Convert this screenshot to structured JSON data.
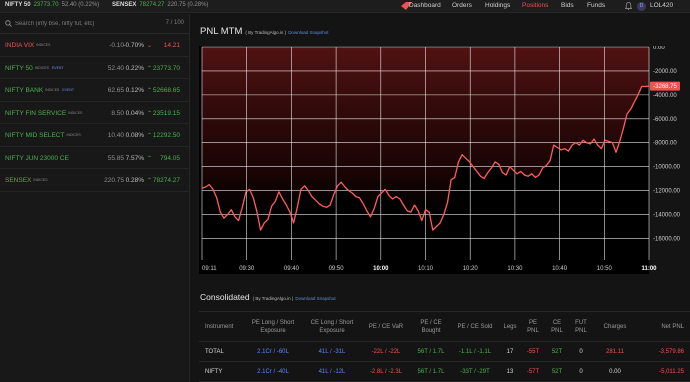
{
  "colors": {
    "green": "#4caf50",
    "red": "#ef5350",
    "blue": "#5c86ff",
    "accent": "#ef5350",
    "bg": "#141414"
  },
  "topbar": {
    "tickers": [
      {
        "name": "NIFTY 50",
        "value": "23773.70",
        "change": "52.40 (0.22%)"
      },
      {
        "name": "SENSEX",
        "value": "78274.27",
        "change": "220.75 (0.28%)"
      }
    ],
    "logo_icon": "kite-logo-icon",
    "nav": [
      "Dashboard",
      "Orders",
      "Holdings",
      "Positions",
      "Bids",
      "Funds"
    ],
    "active_nav": "Positions",
    "user_initial": "D",
    "user_id": "LOL420"
  },
  "watchlist": {
    "search_placeholder": "Search (infy bse, nifty fut, etc)",
    "count": "7 / 100",
    "items": [
      {
        "name": "INDIA VIX",
        "tag": "INDICES",
        "event": "",
        "change": "-0.10",
        "pct": "-0.70%",
        "dir": "down",
        "ltp": "14.21",
        "name_color": "red"
      },
      {
        "name": "NIFTY 50",
        "tag": "INDICES",
        "event": "EVENT",
        "change": "52.40",
        "pct": "0.22%",
        "dir": "up",
        "ltp": "23773.70",
        "name_color": "green"
      },
      {
        "name": "NIFTY BANK",
        "tag": "INDICES",
        "event": "EVENT",
        "change": "62.65",
        "pct": "0.12%",
        "dir": "up",
        "ltp": "52668.65",
        "name_color": "green"
      },
      {
        "name": "NIFTY FIN SERVICE",
        "tag": "INDICES",
        "event": "",
        "change": "8.50",
        "pct": "0.04%",
        "dir": "up",
        "ltp": "23519.15",
        "name_color": "green"
      },
      {
        "name": "NIFTY MID SELECT",
        "tag": "INDICES",
        "event": "",
        "change": "10.40",
        "pct": "0.08%",
        "dir": "up",
        "ltp": "12292.50",
        "name_color": "green"
      },
      {
        "name": "NIFTY JUN 23000 CE",
        "tag": "",
        "event": "",
        "change": "55.85",
        "pct": "7.57%",
        "dir": "up",
        "ltp": "794.05",
        "name_color": "green"
      },
      {
        "name": "SENSEX",
        "tag": "INDICES",
        "event": "",
        "change": "220.75",
        "pct": "0.28%",
        "dir": "up",
        "ltp": "78274.27",
        "name_color": "green"
      }
    ]
  },
  "pnl": {
    "title": "PNL MTM",
    "by": "( By TradingAlgo.in )",
    "download": "Download Snapshot"
  },
  "chart_data": {
    "type": "area",
    "title": "",
    "xlabel": "",
    "ylabel": "",
    "x_ticks": [
      "09:11",
      "09:30",
      "09:40",
      "09:50",
      "10:00",
      "10:10",
      "10:20",
      "10:30",
      "10:40",
      "10:50",
      "11:00"
    ],
    "x_ticks_bold": [
      "10:00",
      "11:00"
    ],
    "y_ticks": [
      0,
      -2000,
      -4000,
      -6000,
      -8000,
      -10000,
      -12000,
      -14000,
      -16000
    ],
    "y_tick_labels": [
      "0.00",
      "-2000.00",
      "-4000.00",
      "-6000.00",
      "-8000.00",
      "-10000.00",
      "-12000.00",
      "-14000.00",
      "-16000.00"
    ],
    "ylim": [
      -17800,
      0
    ],
    "grid": true,
    "last_value_label": "-3268.75",
    "series": [
      {
        "values": [
          -11800,
          -11700,
          -11500,
          -11900,
          -12600,
          -13800,
          -14300,
          -14000,
          -13600,
          -14200,
          -14500,
          -13400,
          -12100,
          -11900,
          -12600,
          -13800,
          -15300,
          -14700,
          -14400,
          -13300,
          -12900,
          -12100,
          -12700,
          -13200,
          -13800,
          -14700,
          -13400,
          -11900,
          -11600,
          -12000,
          -12500,
          -12800,
          -13100,
          -13300,
          -13400,
          -13200,
          -12300,
          -11600,
          -11300,
          -11700,
          -12000,
          -12200,
          -12500,
          -12600,
          -13100,
          -13700,
          -14200,
          -13500,
          -12500,
          -12200,
          -11900,
          -12400,
          -12700,
          -12500,
          -12700,
          -13200,
          -13700,
          -13800,
          -13200,
          -13700,
          -14500,
          -13600,
          -13800,
          -15300,
          -15000,
          -14700,
          -14000,
          -13000,
          -11100,
          -10900,
          -9600,
          -9000,
          -9300,
          -9600,
          -10000,
          -10400,
          -10800,
          -11000,
          -10500,
          -10100,
          -9600,
          -9800,
          -10500,
          -10700,
          -10000,
          -10300,
          -10600,
          -10400,
          -10700,
          -10800,
          -10600,
          -10900,
          -10700,
          -10100,
          -9900,
          -9500,
          -8200,
          -8400,
          -8600,
          -8500,
          -8700,
          -8200,
          -8000,
          -8200,
          -7800,
          -8000,
          -8100,
          -7700,
          -8200,
          -8500,
          -7800,
          -7900,
          -8000,
          -8800,
          -7900,
          -6800,
          -5600,
          -5200,
          -4600,
          -4000,
          -3300,
          -3300,
          -3270
        ]
      }
    ]
  },
  "consolidated": {
    "title": "Consolidated",
    "by": "( By TradingAlgo.in )",
    "download": "Download Snapshot",
    "headers": [
      "Instrument",
      "PE Long / Short Exposure",
      "CE Long / Short Exposure",
      "PE / CE VaR",
      "PE / CE Bought",
      "PE / CE Sold",
      "Legs",
      "PE PNL",
      "CE PNL",
      "FUT PNL",
      "Charges",
      "Net PNL"
    ],
    "rows": [
      {
        "instrument": "TOTAL",
        "pe_exp": "2.1Cr / -60L",
        "ce_exp": "41L / -31L",
        "var": "-22L / -22L",
        "bought": "56T / 1.7L",
        "sold": "-1.1L / -1.1L",
        "legs": "17",
        "pe_pnl": "-55T",
        "ce_pnl": "52T",
        "fut_pnl": "0",
        "charges": "281.11",
        "net_pnl": "-3,579.86"
      },
      {
        "instrument": "NIFTY",
        "pe_exp": "2.1Cr / -40L",
        "ce_exp": "41L / -12L",
        "var": "-2.8L / -2.3L",
        "bought": "56T / 1.7L",
        "sold": "-33T / -29T",
        "legs": "13",
        "pe_pnl": "-57T",
        "ce_pnl": "52T",
        "fut_pnl": "0",
        "charges": "0.00",
        "net_pnl": "-5,011.25"
      }
    ]
  }
}
